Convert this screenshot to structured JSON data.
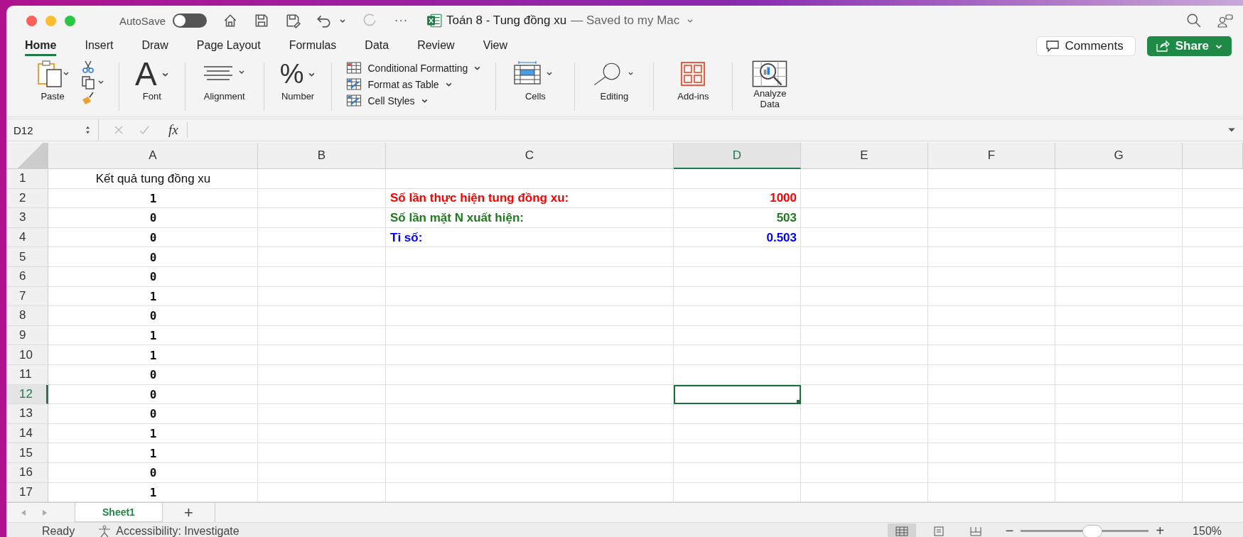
{
  "window": {
    "autosave_label": "AutoSave",
    "autosave_on": false,
    "more": "···",
    "file_name": "Toán 8 - Tung đồng xu",
    "save_status": "— Saved to my Mac"
  },
  "tabs": [
    {
      "label": "Home",
      "selected": true
    },
    {
      "label": "Insert",
      "selected": false
    },
    {
      "label": "Draw",
      "selected": false
    },
    {
      "label": "Page Layout",
      "selected": false
    },
    {
      "label": "Formulas",
      "selected": false
    },
    {
      "label": "Data",
      "selected": false
    },
    {
      "label": "Review",
      "selected": false
    },
    {
      "label": "View",
      "selected": false
    }
  ],
  "comments_button": "Comments",
  "share_button": "Share",
  "ribbon": [
    {
      "kind": "paste",
      "label": "Paste"
    },
    {
      "kind": "font",
      "glyph": "A",
      "label": "Font"
    },
    {
      "kind": "alignment",
      "label": "Alignment"
    },
    {
      "kind": "number",
      "glyph": "%",
      "label": "Number"
    },
    {
      "kind": "styles",
      "items": [
        "Conditional Formatting",
        "Format as Table",
        "Cell Styles"
      ]
    },
    {
      "kind": "cells",
      "label": "Cells"
    },
    {
      "kind": "editing",
      "label": "Editing"
    },
    {
      "kind": "addins",
      "label": "Add-ins"
    },
    {
      "kind": "analyze",
      "label": "Analyze Data"
    }
  ],
  "formula_bar": {
    "name_box": "D12",
    "function_label": "fx"
  },
  "columns": [
    {
      "label": "A",
      "selected": false
    },
    {
      "label": "B",
      "selected": false
    },
    {
      "label": "C",
      "selected": false
    },
    {
      "label": "D",
      "selected": true
    },
    {
      "label": "E",
      "selected": false
    },
    {
      "label": "F",
      "selected": false
    },
    {
      "label": "G",
      "selected": false
    }
  ],
  "rows": [
    {
      "number": "1",
      "selected": false,
      "a": "Kết quả tung đồng xu"
    },
    {
      "number": "2",
      "selected": false,
      "a": "1",
      "c": "Số lần thực hiện tung đồng xu:",
      "d": "1000",
      "color": "#ff0000"
    },
    {
      "number": "3",
      "selected": false,
      "a": "0",
      "c": "Số lần mặt N xuất hiện:",
      "d": "503",
      "color": "#1e7b1e"
    },
    {
      "number": "4",
      "selected": false,
      "a": "0",
      "c": "Tỉ số:",
      "d": "0.503",
      "color": "#0000ff"
    },
    {
      "number": "5",
      "selected": false,
      "a": "0"
    },
    {
      "number": "6",
      "selected": false,
      "a": "0"
    },
    {
      "number": "7",
      "selected": false,
      "a": "1"
    },
    {
      "number": "8",
      "selected": false,
      "a": "0"
    },
    {
      "number": "9",
      "selected": false,
      "a": "1"
    },
    {
      "number": "10",
      "selected": false,
      "a": "1"
    },
    {
      "number": "11",
      "selected": false,
      "a": "0"
    },
    {
      "number": "12",
      "selected": true,
      "a": "0"
    },
    {
      "number": "13",
      "selected": false,
      "a": "0"
    },
    {
      "number": "14",
      "selected": false,
      "a": "1"
    },
    {
      "number": "15",
      "selected": false,
      "a": "1"
    },
    {
      "number": "16",
      "selected": false,
      "a": "0"
    },
    {
      "number": "17",
      "selected": false,
      "a": "1"
    }
  ],
  "sheet_tabs": [
    {
      "label": "Sheet1",
      "selected": true
    }
  ],
  "add_sheet": "+",
  "status_bar": {
    "ready": "Ready",
    "accessibility": "Accessibility: Investigate",
    "view_buttons": [
      {
        "kind": "normal",
        "selected": true
      },
      {
        "kind": "page_layout",
        "selected": false
      },
      {
        "kind": "page_break",
        "selected": false
      }
    ],
    "zoom_out": "−",
    "zoom_in": "+",
    "zoom": {
      "level": 0.57
    },
    "zoom_label": "150%"
  }
}
